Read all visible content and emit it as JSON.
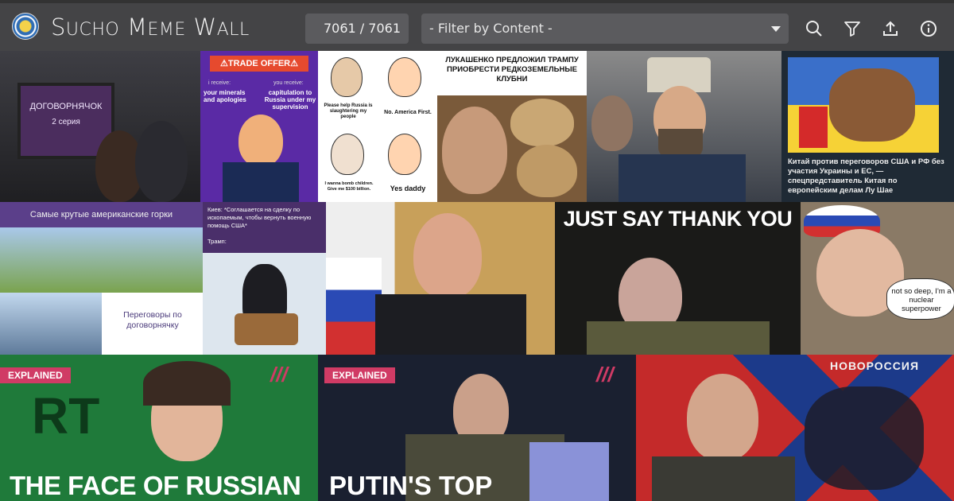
{
  "header": {
    "title_big_1": "S",
    "title_small_1": "UCHO",
    "title_big_2": " M",
    "title_small_2": "EME",
    "title_big_3": " W",
    "title_small_3": "ALL",
    "counter": "7061 / 7061",
    "filter_placeholder": "- Filter by Content -",
    "icons": [
      "search-icon",
      "filter-icon",
      "upload-icon",
      "info-icon"
    ]
  },
  "memes": {
    "m1": {
      "sign": "ДОГОВОРНЯЧОК",
      "sub": "2 серия"
    },
    "m2": {
      "banner": "⚠TRADE OFFER⚠",
      "i_receive": "i receive:",
      "you_receive": "you receive:",
      "left": "your minerals and apologies",
      "right": "capitulation to Russia under my supervision"
    },
    "m3": {
      "a": "Please help Russia is slaughtering my people",
      "b": "No. America First.",
      "c": "I wanna bomb children. Give me $100 billion.",
      "d": "Yes daddy"
    },
    "m4": {
      "headline": "ЛУКАШЕНКО ПРЕДЛОЖИЛ ТРАМПУ ПРИОБРЕСТИ РЕДКОЗЕМЕЛЬНЫЕ КЛУБНИ"
    },
    "m6": {
      "caption": "Китай против переговоров США и РФ без участия Украины и ЕС, — спецпредставитель Китая по европейским делам Лу Шае"
    },
    "m7": {
      "top": "Самые крутые американские горки",
      "bottom": "Переговоры по договорнячку"
    },
    "m8": {
      "text": "Киев: *Соглашается на сделку по ископаемым, чтобы вернуть военную помощь США*",
      "trump": "Трамп:"
    },
    "m10": {
      "headline": "JUST SAY THANK YOU"
    },
    "m11": {
      "bubble": "not so deep, I'm a nuclear superpower"
    },
    "m12": {
      "badge": "EXPLAINED",
      "logo": "RT",
      "headline": "THE FACE OF RUSSIAN"
    },
    "m13": {
      "badge": "EXPLAINED",
      "headline": "PUTIN'S TOP"
    },
    "m14": {
      "flag": "НОВОРОССИЯ"
    }
  }
}
